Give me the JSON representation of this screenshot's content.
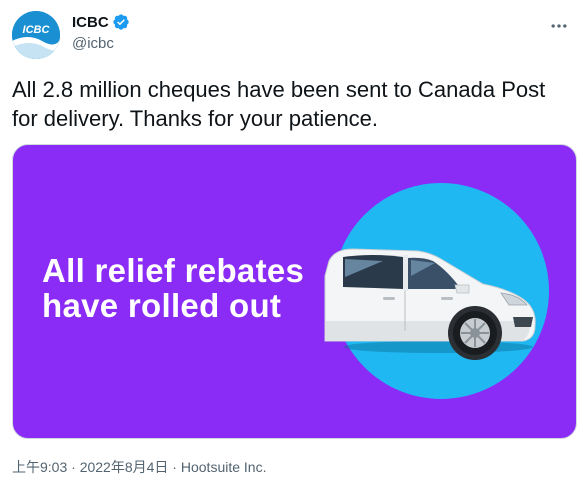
{
  "author": {
    "display_name": "ICBC",
    "handle": "@icbc",
    "avatar_text": "ICBC"
  },
  "tweet": {
    "text_line1": "All 2.8 million cheques have been sent to Canada Post",
    "text_line2": "for delivery. Thanks for your patience."
  },
  "media": {
    "headline_line1": "All relief rebates",
    "headline_line2": "have rolled out",
    "background_color": "#8a2cf5",
    "circle_color": "#1fb8f2"
  },
  "meta": {
    "time": "上午9:03",
    "separator1": " · ",
    "date": "2022年8月4日",
    "separator2": " · ",
    "source": "Hootsuite Inc."
  },
  "icons": {
    "verified": "verified-badge-icon",
    "more": "more-options-icon"
  }
}
